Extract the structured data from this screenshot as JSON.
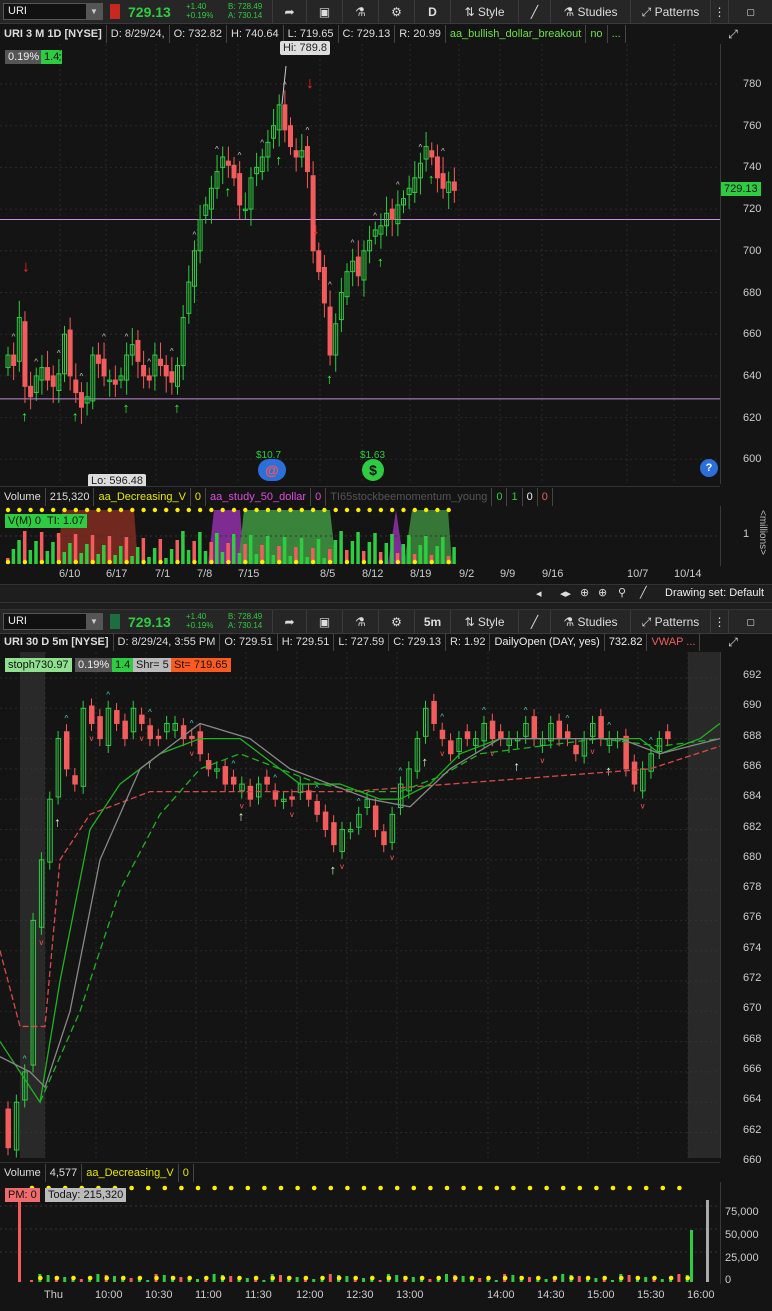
{
  "top": {
    "symbol": "URI",
    "last": "729.13",
    "change": "+1.40",
    "change_pct": "+0.19%",
    "bid": "B: 728.49",
    "ask": "A: 730.14",
    "aggregation": "D",
    "style_label": "Style",
    "studies_label": "Studies",
    "patterns_label": "Patterns",
    "info": {
      "title": "URI 3 M 1D [NYSE]",
      "date": "D: 8/29/24,",
      "open": "O: 732.82",
      "high": "H: 740.64",
      "low": "L: 719.65",
      "close": "C: 729.13",
      "range": "R: 20.99",
      "study": "aa_bullish_dollar_breakout",
      "study_val": "no",
      "more": "..."
    },
    "badge_pct": "0.19%",
    "badge_val": "1.4",
    "hi_label": "Hi: 789.8",
    "lo_label": "Lo: 596.48",
    "price_tag": "729.13",
    "events": [
      {
        "label": "$10.7"
      },
      {
        "label": "$1.63"
      }
    ],
    "yticks": [
      "780",
      "760",
      "740",
      "720",
      "700",
      "680",
      "660",
      "640",
      "620",
      "600"
    ],
    "volume": {
      "label": "Volume",
      "value": "215,320",
      "study1": "aa_Decreasing_V",
      "study1_val": "0",
      "study2": "aa_study_50_dollar",
      "study2_val": "0",
      "study3": "TI65stockbeemomentum_young",
      "study3_vals": [
        "0",
        "1",
        "0",
        "0"
      ],
      "vm_label": "V(M) 0",
      "ti_label": "TI: 1.07",
      "yticks": [
        "1"
      ],
      "unit": "<millions>"
    },
    "xticks": [
      "6/10",
      "6/17",
      "7/1",
      "7/8",
      "7/15",
      "8/5",
      "8/12",
      "8/19",
      "9/2",
      "9/9",
      "9/16",
      "10/7",
      "10/14"
    ],
    "drawing_set": "Drawing set: Default"
  },
  "bottom": {
    "symbol": "URI",
    "last": "729.13",
    "change": "+1.40",
    "change_pct": "+0.19%",
    "bid": "B: 728.49",
    "ask": "A: 730.14",
    "aggregation": "5m",
    "style_label": "Style",
    "studies_label": "Studies",
    "patterns_label": "Patterns",
    "info": {
      "title": "URI 30 D 5m [NYSE]",
      "date": "D: 8/29/24, 3:55 PM",
      "open": "O: 729.51",
      "high": "H: 729.51",
      "low": "L: 727.59",
      "close": "C: 729.13",
      "range": "R: 1.92",
      "study": "DailyOpen (DAY, yes)",
      "study_val": "732.82",
      "vwap": "VWAP ..."
    },
    "stoph": "stoph730.97",
    "badge_pct": "0.19%",
    "badge_val": "1.4",
    "shr": "Shr= 5",
    "st": "St= 719.65",
    "yticks": [
      "692",
      "690",
      "688",
      "686",
      "684",
      "682",
      "680",
      "678",
      "676",
      "674",
      "672",
      "670",
      "668",
      "666",
      "664",
      "662",
      "660"
    ],
    "volume": {
      "label": "Volume",
      "value": "4,577",
      "study1": "aa_Decreasing_V",
      "study1_val": "0",
      "pm_label": "PM: 0",
      "today_label": "Today: 215,320",
      "yticks": [
        "75,000",
        "50,000",
        "25,000",
        "0"
      ]
    },
    "xticks": [
      "Thu",
      "10:00",
      "10:30",
      "11:00",
      "11:30",
      "12:00",
      "12:30",
      "13:00",
      "14:00",
      "14:30",
      "15:00",
      "15:30",
      "16:00"
    ]
  },
  "colors": {
    "up": "#2ecc40",
    "down": "#f25c5c",
    "accent": "#2ecc40",
    "stop": "#ff5a1f"
  }
}
